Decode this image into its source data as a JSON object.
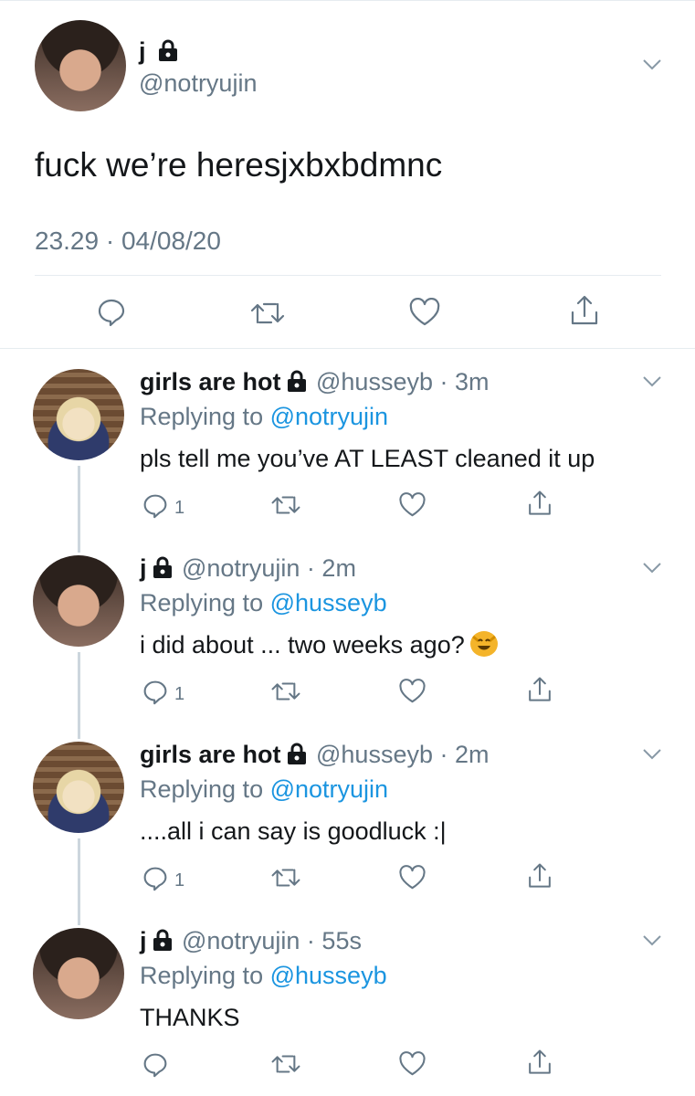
{
  "main_tweet": {
    "name": "j",
    "handle": "@notryujin",
    "text": "fuck we’re heresjxbxbdmnc",
    "timestamp": "23.29 · 04/08/20"
  },
  "replies": [
    {
      "name": "girls are hot",
      "handle_time": "@husseyb · 3m",
      "replying_label": "Replying to",
      "replying_to": "@notryujin",
      "text": "pls tell me you’ve AT LEAST cleaned it up",
      "reply_count": "1"
    },
    {
      "name": "j",
      "handle_time": "@notryujin · 2m",
      "replying_label": "Replying to",
      "replying_to": "@husseyb",
      "text": "i did about ... two weeks ago?",
      "emoji": "smiling-cat-emoji",
      "reply_count": "1"
    },
    {
      "name": "girls are hot",
      "handle_time": "@husseyb · 2m",
      "replying_label": "Replying to",
      "replying_to": "@notryujin",
      "text": "....all i can say is goodluck :|",
      "reply_count": "1"
    },
    {
      "name": "j",
      "handle_time": "@notryujin · 55s",
      "replying_label": "Replying to",
      "replying_to": "@husseyb",
      "text": "THANKS",
      "reply_count": ""
    }
  ],
  "colors": {
    "text": "#14171a",
    "secondary": "#657786",
    "link": "#1b95e0",
    "divider": "#e6ecf0",
    "thread_line": "#ccd6dd"
  }
}
